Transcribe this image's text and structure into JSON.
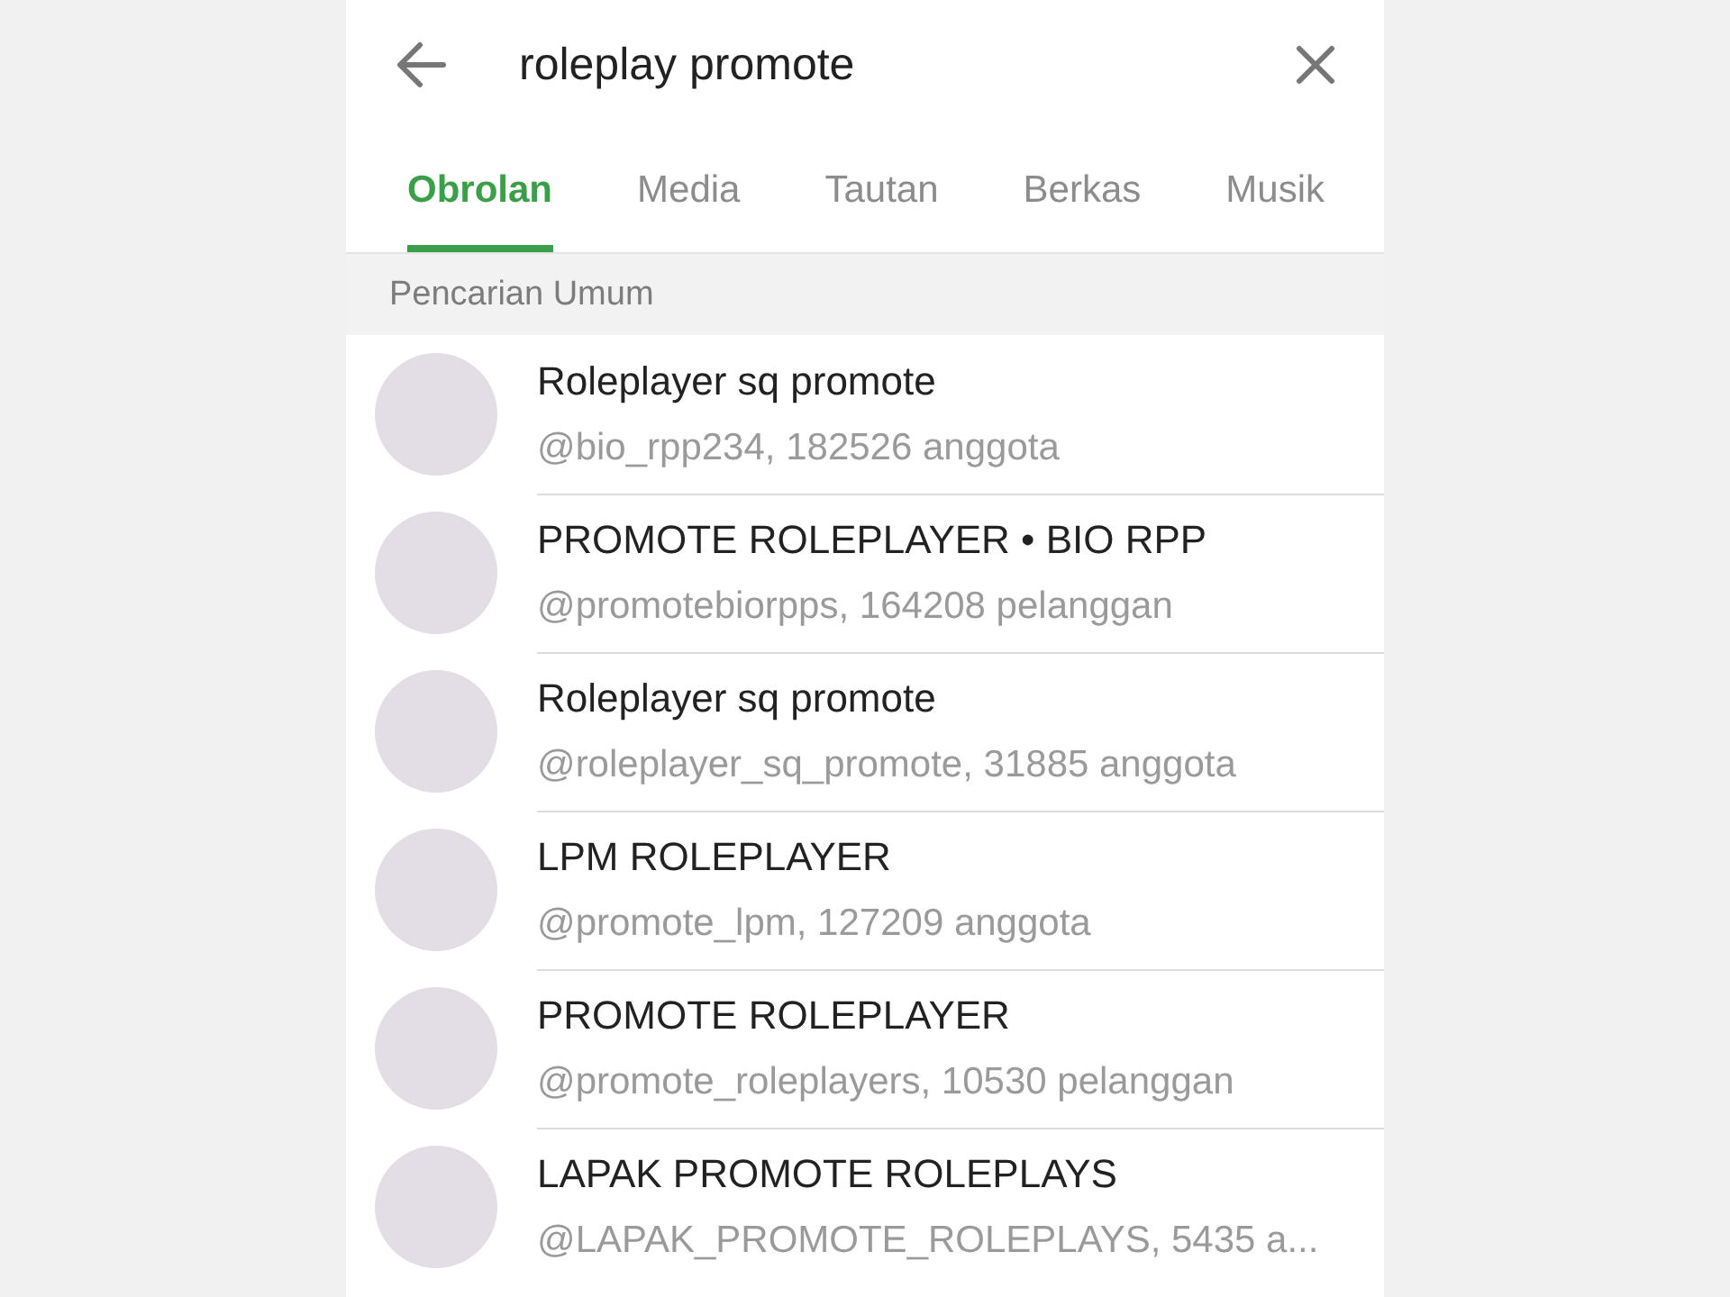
{
  "search": {
    "value": "roleplay promote"
  },
  "tabs": [
    {
      "label": "Obrolan",
      "selected": true
    },
    {
      "label": "Media",
      "selected": false
    },
    {
      "label": "Tautan",
      "selected": false
    },
    {
      "label": "Berkas",
      "selected": false
    },
    {
      "label": "Musik",
      "selected": false
    }
  ],
  "section_header": "Pencarian Umum",
  "results": [
    {
      "title": "Roleplayer sq promote",
      "subtitle": "@bio_rpp234, 182526 anggota"
    },
    {
      "title": "PROMOTE ROLEPLAYER • BIO RPP",
      "subtitle": "@promotebiorpps, 164208  pelanggan"
    },
    {
      "title": "Roleplayer sq promote",
      "subtitle": "@roleplayer_sq_promote, 31885 anggota"
    },
    {
      "title": "LPM ROLEPLAYER",
      "subtitle": "@promote_lpm, 127209 anggota"
    },
    {
      "title": "PROMOTE ROLEPLAYER",
      "subtitle": "@promote_roleplayers, 10530  pelanggan"
    },
    {
      "title": "LAPAK PROMOTE ROLEPLAYS",
      "subtitle": "@LAPAK_PROMOTE_ROLEPLAYS, 5435 a..."
    }
  ]
}
